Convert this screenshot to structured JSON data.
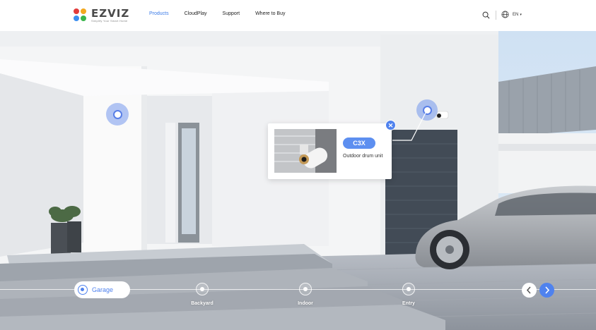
{
  "brand": {
    "name": "EZVIZ",
    "tagline": "Simplify Your Smart Home"
  },
  "nav": {
    "items": [
      "Products",
      "CloudPlay",
      "Support",
      "Where to Buy"
    ],
    "active": "Products"
  },
  "header": {
    "language": "EN"
  },
  "popup": {
    "product": "C3X",
    "description": "Outdoor drum unit"
  },
  "timeline": {
    "active": "Garage",
    "stops": [
      "Backyard",
      "Indoor",
      "Entry"
    ]
  },
  "colors": {
    "accent": "#4f82ee",
    "hotspot": "#5882eb",
    "header_bg": "#ffffff"
  },
  "icons": [
    "search-icon",
    "globe-icon",
    "chevron-down-icon",
    "close-icon",
    "chevron-left-icon",
    "chevron-right-icon"
  ]
}
